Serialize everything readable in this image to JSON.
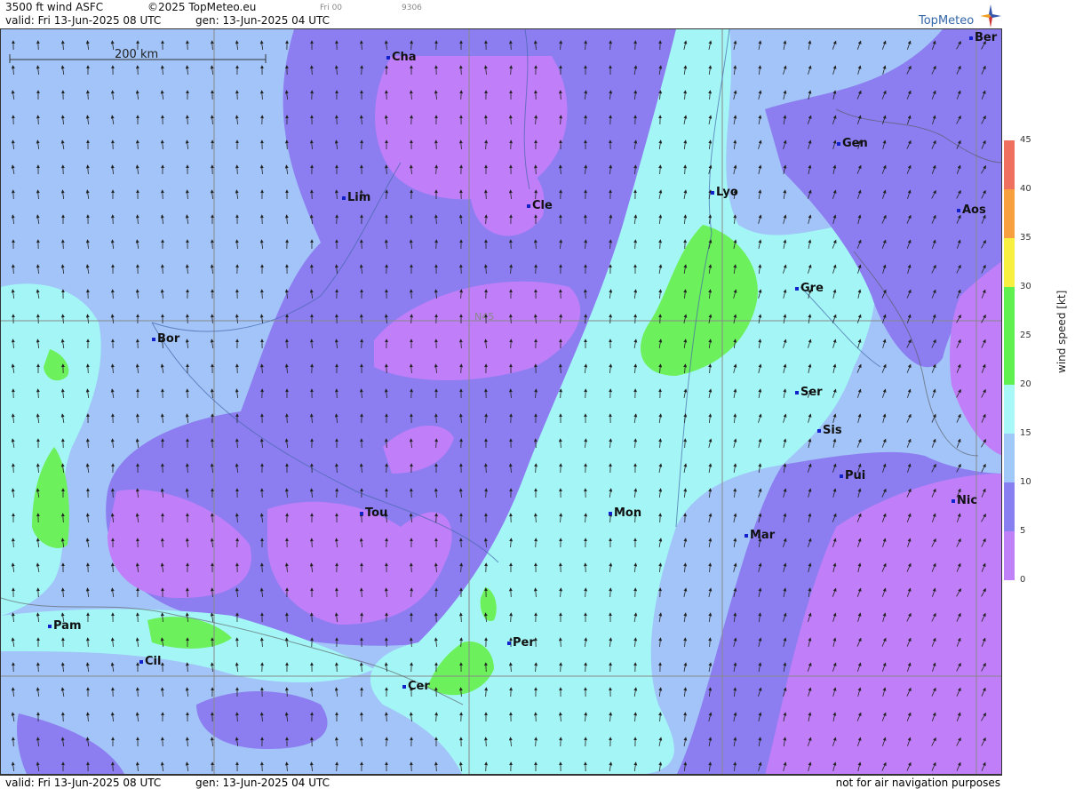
{
  "header": {
    "title": "3500 ft wind ASFC",
    "copyright": "©2025 TopMeteo.eu",
    "run": "Fri 00",
    "code": "9306",
    "valid": "valid:  Fri  13-Jun-2025  08 UTC",
    "gen": "gen: 13-Jun-2025  04 UTC"
  },
  "logo": {
    "text": "TopMeteo",
    "icon": "compass-star-icon"
  },
  "footer": {
    "valid": "valid:  Fri  13-Jun-2025  08 UTC",
    "gen": "gen: 13-Jun-2025  04 UTC",
    "disclaimer": "not for air navigation purposes"
  },
  "map": {
    "scale_label": "200 km",
    "lat_label": "N45",
    "cities": [
      "Cha",
      "Ber",
      "Gen",
      "Lim",
      "Cle",
      "Lyo",
      "Aos",
      "Gre",
      "Bor",
      "Ser",
      "Sis",
      "Pui",
      "Nic",
      "Tou",
      "Mon",
      "Mar",
      "Pam",
      "Per",
      "Cil",
      "Cer"
    ]
  },
  "legend": {
    "unit": "wind speed [kt]",
    "ticks": [
      "45",
      "40",
      "35",
      "30",
      "25",
      "20",
      "15",
      "10",
      "5",
      "0"
    ],
    "colors": [
      "#f07060",
      "#f8a040",
      "#f8f040",
      "#60f050",
      "#a8f8f8",
      "#a0c8f8",
      "#8880f0",
      "#c080f8"
    ]
  },
  "colors": {
    "purple": "#c07ef8",
    "violet": "#8c7ef0",
    "blue": "#a2c4f8",
    "cyan": "#a4f6f6",
    "green": "#6cf05c"
  }
}
